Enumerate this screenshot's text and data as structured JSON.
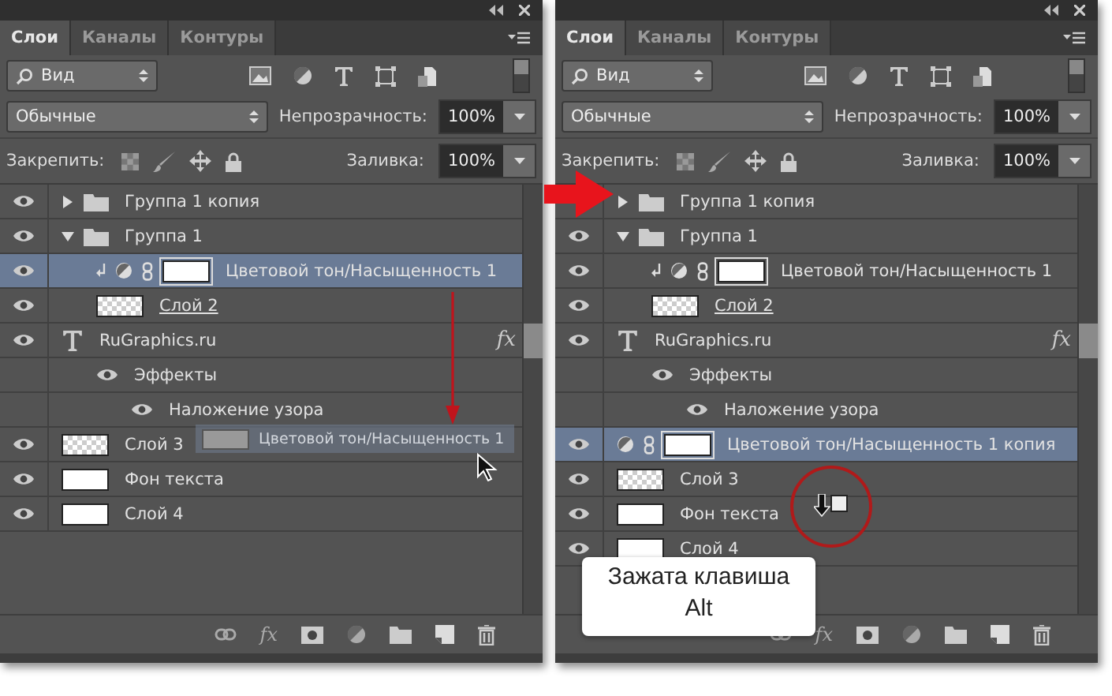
{
  "panels": [
    {
      "tabs": [
        {
          "label": "Слои",
          "selected": true
        },
        {
          "label": "Каналы",
          "selected": false
        },
        {
          "label": "Контуры",
          "selected": false
        }
      ],
      "filter": {
        "value": "Вид"
      },
      "blend_mode": "Обычные",
      "opacity": {
        "label": "Непрозрачность:",
        "value": "100%"
      },
      "lock": {
        "label": "Закрепить:"
      },
      "fill": {
        "label": "Заливка:",
        "value": "100%"
      },
      "footer": {
        "fx": "fx"
      },
      "layers": [
        {
          "kind": "group",
          "name": "Группа 1 копия",
          "visible": true,
          "expanded": false,
          "selected": false
        },
        {
          "kind": "group",
          "name": "Группа 1",
          "visible": true,
          "expanded": true,
          "selected": false,
          "children": [
            {
              "kind": "adjustment",
              "name": "Цветовой тон/Насыщенность 1",
              "visible": true,
              "clipped": true,
              "selected": true
            },
            {
              "kind": "pixel",
              "name": "Слой 2",
              "visible": true,
              "transparent": true,
              "clip_base": true,
              "selected": false
            }
          ]
        },
        {
          "kind": "text",
          "name": "RuGraphics.ru",
          "visible": true,
          "fx": "fx",
          "selected": false,
          "children": [
            {
              "kind": "effects",
              "name": "Эффекты",
              "visible": true,
              "selected": false,
              "children": [
                {
                  "kind": "effect",
                  "name": "Наложение узора",
                  "visible": true,
                  "selected": false
                }
              ]
            }
          ]
        },
        {
          "kind": "pixel",
          "name": "Слой 3",
          "visible": true,
          "transparent": true,
          "clip_base": false,
          "selected": false
        },
        {
          "kind": "pixel",
          "name": "Фон текста",
          "visible": true,
          "transparent": false,
          "clip_base": false,
          "selected": false
        },
        {
          "kind": "pixel",
          "name": "Слой 4",
          "visible": true,
          "transparent": false,
          "clip_base": false,
          "selected": false
        }
      ],
      "drag_ghost": {
        "name": "Цветовой тон/Насыщенность 1"
      }
    },
    {
      "tabs": [
        {
          "label": "Слои",
          "selected": true
        },
        {
          "label": "Каналы",
          "selected": false
        },
        {
          "label": "Контуры",
          "selected": false
        }
      ],
      "filter": {
        "value": "Вид"
      },
      "blend_mode": "Обычные",
      "opacity": {
        "label": "Непрозрачность:",
        "value": "100%"
      },
      "lock": {
        "label": "Закрепить:"
      },
      "fill": {
        "label": "Заливка:",
        "value": "100%"
      },
      "footer": {
        "fx": "fx"
      },
      "layers": [
        {
          "kind": "group",
          "name": "Группа 1 копия",
          "visible": false,
          "expanded": false,
          "selected": false
        },
        {
          "kind": "group",
          "name": "Группа 1",
          "visible": true,
          "expanded": true,
          "selected": false,
          "children": [
            {
              "kind": "adjustment",
              "name": "Цветовой тон/Насыщенность 1",
              "visible": true,
              "clipped": true,
              "selected": false
            },
            {
              "kind": "pixel",
              "name": "Слой 2",
              "visible": true,
              "transparent": true,
              "clip_base": true,
              "selected": false
            }
          ]
        },
        {
          "kind": "text",
          "name": "RuGraphics.ru",
          "visible": true,
          "fx": "fx",
          "selected": false,
          "children": [
            {
              "kind": "effects",
              "name": "Эффекты",
              "visible": true,
              "selected": false,
              "children": [
                {
                  "kind": "effect",
                  "name": "Наложение узора",
                  "visible": true,
                  "selected": false
                }
              ]
            }
          ]
        },
        {
          "kind": "adjustment",
          "name": "Цветовой тон/Насыщенность 1 копия",
          "visible": true,
          "clipped": false,
          "selected": true
        },
        {
          "kind": "pixel",
          "name": "Слой 3",
          "visible": true,
          "transparent": true,
          "clip_base": false,
          "selected": false
        },
        {
          "kind": "pixel",
          "name": "Фон текста",
          "visible": true,
          "transparent": false,
          "clip_base": false,
          "selected": false
        },
        {
          "kind": "pixel",
          "name": "Слой 4",
          "visible": true,
          "transparent": false,
          "clip_base": false,
          "selected": false
        }
      ],
      "callout": {
        "text": "Зажата клавиша\nAlt"
      }
    }
  ]
}
